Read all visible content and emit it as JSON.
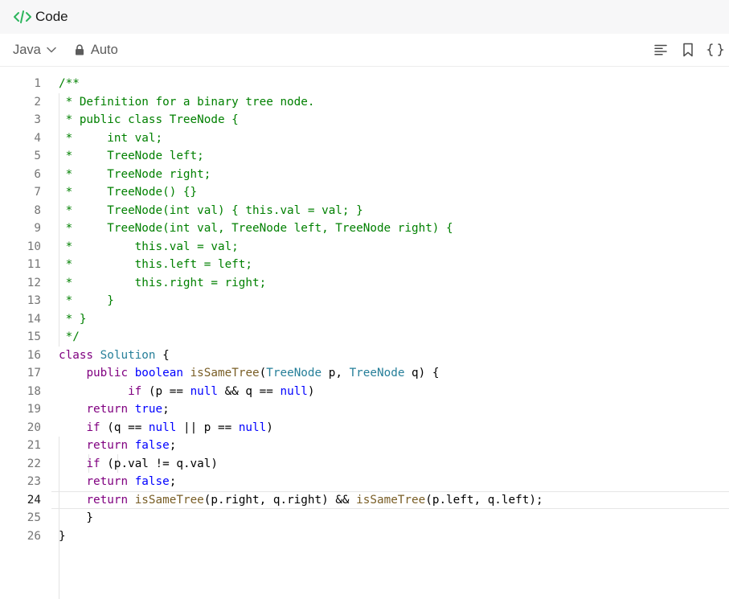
{
  "header": {
    "title": "Code",
    "icon": "code-brackets-icon",
    "accent": "#2db55d"
  },
  "toolbar": {
    "language": "Java",
    "mode": "Auto",
    "icons": [
      "format-lines-icon",
      "bookmark-icon",
      "braces-icon"
    ]
  },
  "editor": {
    "active_line": 24,
    "colors": {
      "comment": "#008000",
      "keyword": "#800080",
      "literal": "#0000ff",
      "type": "#267f99",
      "function": "#795e26",
      "identifier": "#001080"
    },
    "lines": [
      {
        "n": "1",
        "tokens": [
          [
            "cm",
            "/**"
          ]
        ]
      },
      {
        "n": "2",
        "tokens": [
          [
            "cm",
            " * Definition for a binary tree node."
          ]
        ]
      },
      {
        "n": "3",
        "tokens": [
          [
            "cm",
            " * public class TreeNode {"
          ]
        ]
      },
      {
        "n": "4",
        "tokens": [
          [
            "cm",
            " *     int val;"
          ]
        ]
      },
      {
        "n": "5",
        "tokens": [
          [
            "cm",
            " *     TreeNode left;"
          ]
        ]
      },
      {
        "n": "6",
        "tokens": [
          [
            "cm",
            " *     TreeNode right;"
          ]
        ]
      },
      {
        "n": "7",
        "tokens": [
          [
            "cm",
            " *     TreeNode() {}"
          ]
        ]
      },
      {
        "n": "8",
        "tokens": [
          [
            "cm",
            " *     TreeNode(int val) { this.val = val; }"
          ]
        ]
      },
      {
        "n": "9",
        "tokens": [
          [
            "cm",
            " *     TreeNode(int val, TreeNode left, TreeNode right) {"
          ]
        ]
      },
      {
        "n": "10",
        "tokens": [
          [
            "cm",
            " *         this.val = val;"
          ]
        ]
      },
      {
        "n": "11",
        "tokens": [
          [
            "cm",
            " *         this.left = left;"
          ]
        ]
      },
      {
        "n": "12",
        "tokens": [
          [
            "cm",
            " *         this.right = right;"
          ]
        ]
      },
      {
        "n": "13",
        "tokens": [
          [
            "cm",
            " *     }"
          ]
        ]
      },
      {
        "n": "14",
        "tokens": [
          [
            "cm",
            " * }"
          ]
        ]
      },
      {
        "n": "15",
        "tokens": [
          [
            "cm",
            " */"
          ]
        ]
      },
      {
        "n": "16",
        "tokens": [
          [
            "kw",
            "class"
          ],
          [
            "",
            " "
          ],
          [
            "ty",
            "Solution"
          ],
          [
            "",
            " {"
          ]
        ]
      },
      {
        "n": "17",
        "tokens": [
          [
            "",
            "    "
          ],
          [
            "kw",
            "public"
          ],
          [
            "",
            " "
          ],
          [
            "lit",
            "boolean"
          ],
          [
            "",
            " "
          ],
          [
            "fn",
            "isSameTree"
          ],
          [
            "",
            "("
          ],
          [
            "ty",
            "TreeNode"
          ],
          [
            "",
            " p, "
          ],
          [
            "ty",
            "TreeNode"
          ],
          [
            "",
            " q) {"
          ]
        ]
      },
      {
        "n": "18",
        "tokens": [
          [
            "",
            "          "
          ],
          [
            "kw",
            "if"
          ],
          [
            "",
            " (p == "
          ],
          [
            "lit",
            "null"
          ],
          [
            "",
            " && q == "
          ],
          [
            "lit",
            "null"
          ],
          [
            "",
            ")"
          ]
        ]
      },
      {
        "n": "19",
        "tokens": [
          [
            "",
            "    "
          ],
          [
            "kw",
            "return"
          ],
          [
            "",
            " "
          ],
          [
            "lit",
            "true"
          ],
          [
            "",
            ";"
          ]
        ]
      },
      {
        "n": "20",
        "tokens": [
          [
            "",
            "    "
          ],
          [
            "kw",
            "if"
          ],
          [
            "",
            " (q == "
          ],
          [
            "lit",
            "null"
          ],
          [
            "",
            " || p == "
          ],
          [
            "lit",
            "null"
          ],
          [
            "",
            ")"
          ]
        ]
      },
      {
        "n": "21",
        "tokens": [
          [
            "",
            "    "
          ],
          [
            "kw",
            "return"
          ],
          [
            "",
            " "
          ],
          [
            "lit",
            "false"
          ],
          [
            "",
            ";"
          ]
        ]
      },
      {
        "n": "22",
        "tokens": [
          [
            "",
            "    "
          ],
          [
            "kw",
            "if"
          ],
          [
            "",
            " (p.val != q.val)"
          ]
        ]
      },
      {
        "n": "23",
        "tokens": [
          [
            "",
            "    "
          ],
          [
            "kw",
            "return"
          ],
          [
            "",
            " "
          ],
          [
            "lit",
            "false"
          ],
          [
            "",
            ";"
          ]
        ]
      },
      {
        "n": "24",
        "tokens": [
          [
            "",
            "    "
          ],
          [
            "kw",
            "return"
          ],
          [
            "",
            " "
          ],
          [
            "fn",
            "isSameTree"
          ],
          [
            "",
            "(p.right, q.right) && "
          ],
          [
            "fn",
            "isSameTree"
          ],
          [
            "",
            "(p.left, q.left);"
          ]
        ]
      },
      {
        "n": "25",
        "tokens": [
          [
            "",
            "    }"
          ]
        ]
      },
      {
        "n": "26",
        "tokens": [
          [
            "",
            "}"
          ]
        ]
      }
    ]
  }
}
